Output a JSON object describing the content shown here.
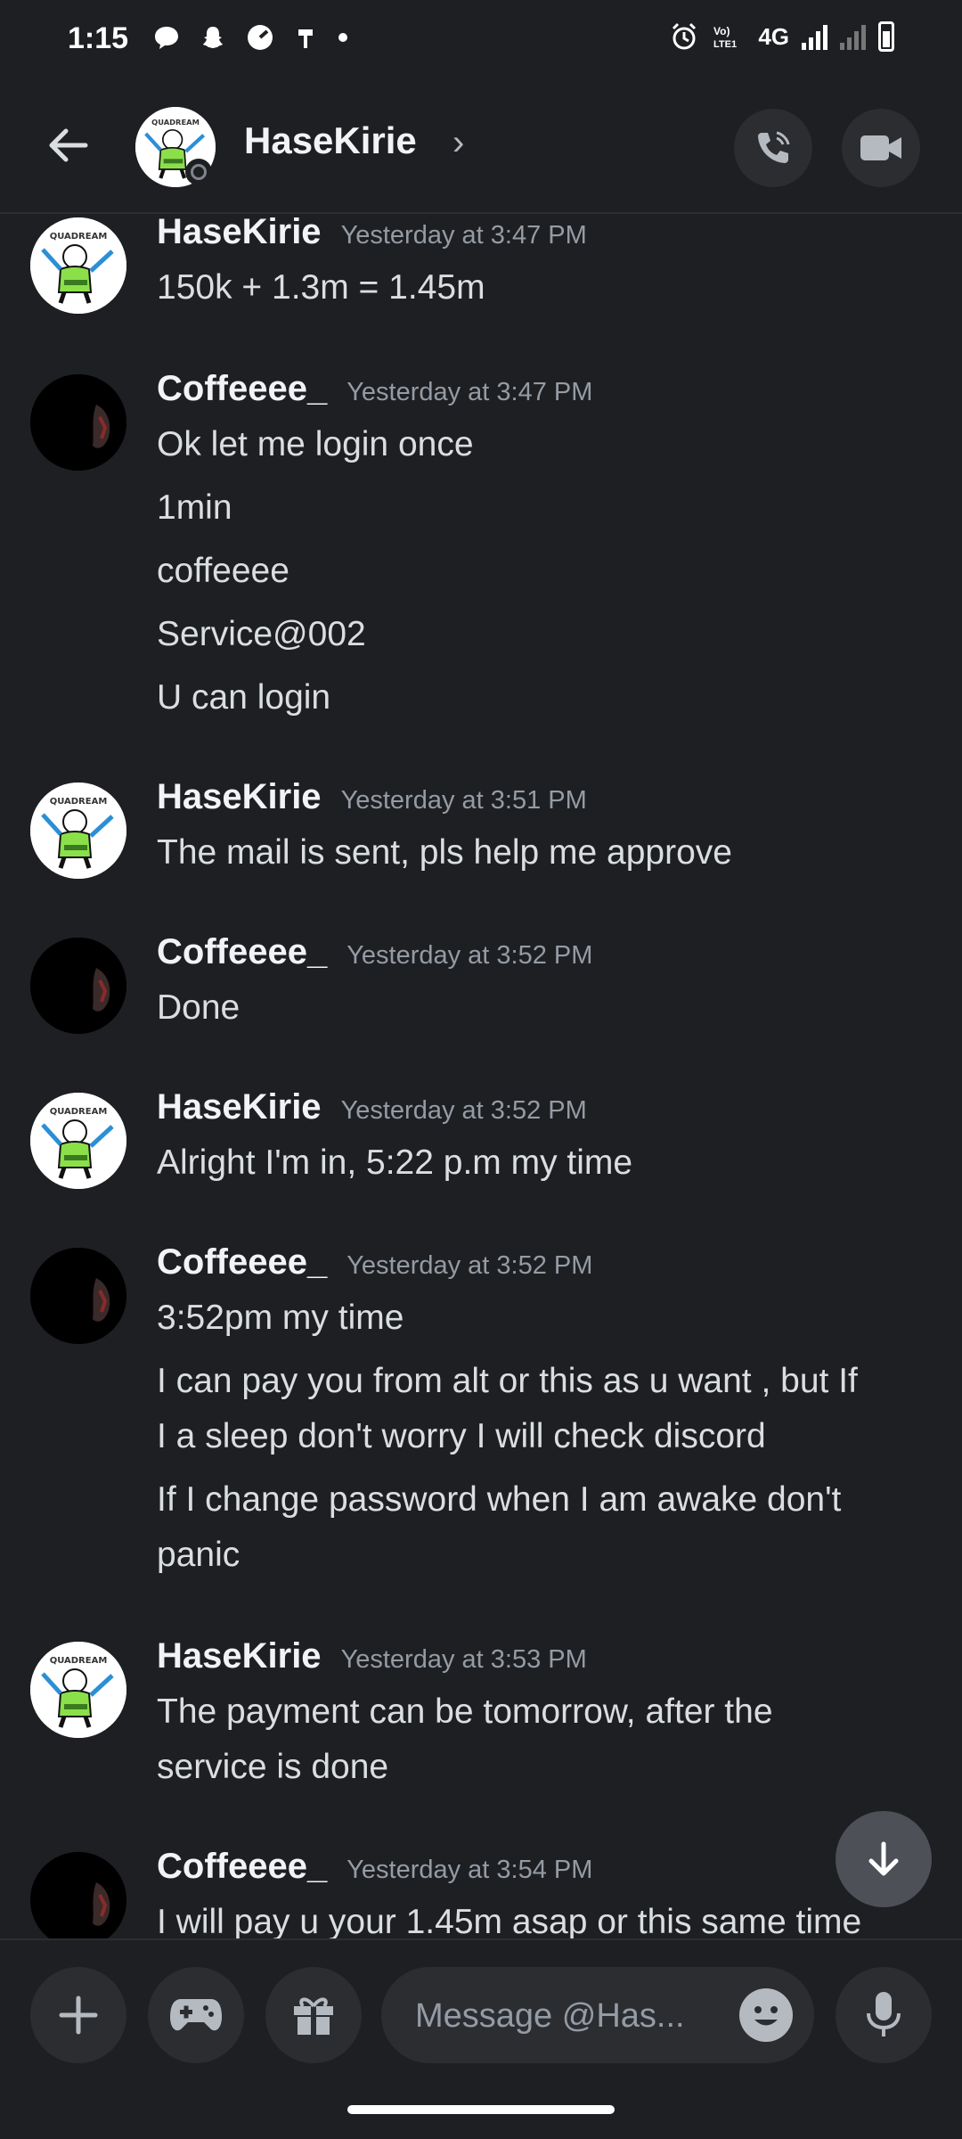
{
  "status_bar": {
    "time": "1:15",
    "network": "4G"
  },
  "header": {
    "name": "HaseKirie",
    "avatar_text": "QUADREAM"
  },
  "messages": [
    {
      "user": "HaseKirie",
      "time": "Yesterday at 3:47 PM",
      "lines": [
        "150k + 1.3m = 1.45m"
      ]
    },
    {
      "user": "Coffeeee_",
      "time": "Yesterday at 3:47 PM",
      "lines": [
        "Ok let me login once",
        "1min",
        "coffeeee",
        "Service@002",
        "U can login"
      ]
    },
    {
      "user": "HaseKirie",
      "time": "Yesterday at 3:51 PM",
      "lines": [
        "The mail is sent, pls help me approve"
      ]
    },
    {
      "user": "Coffeeee_",
      "time": "Yesterday at 3:52 PM",
      "lines": [
        "Done"
      ]
    },
    {
      "user": "HaseKirie",
      "time": "Yesterday at 3:52 PM",
      "lines": [
        "Alright I'm in, 5:22 p.m my time"
      ]
    },
    {
      "user": "Coffeeee_",
      "time": "Yesterday at 3:52 PM",
      "lines": [
        "3:52pm my time",
        "I can pay you from alt or this as u want , but If",
        "I a sleep don't worry I will check discord",
        "If I change password when I am awake don't",
        "panic"
      ]
    },
    {
      "user": "HaseKirie",
      "time": "Yesterday at 3:53 PM",
      "lines": [
        "The payment can be tomorrow, after the",
        "service is done"
      ]
    },
    {
      "user": "Coffeeee_",
      "time": "Yesterday at 3:54 PM",
      "lines": [
        "I will pay u your 1.45m asap or this same time"
      ]
    }
  ],
  "composer": {
    "placeholder": "Message @Has..."
  },
  "icons": {
    "back": "arrow-left-icon",
    "call": "phone-icon",
    "video": "video-camera-icon",
    "add": "plus-icon",
    "games": "gamepad-icon",
    "gift": "gift-icon",
    "emoji": "smiley-icon",
    "mic": "microphone-icon",
    "scroll": "arrow-down-icon"
  },
  "colors": {
    "background": "#1e1f22",
    "surface": "#2b2d31",
    "username": "#f2f3f5",
    "timestamp": "#949ba4",
    "text": "#dbdee1"
  }
}
